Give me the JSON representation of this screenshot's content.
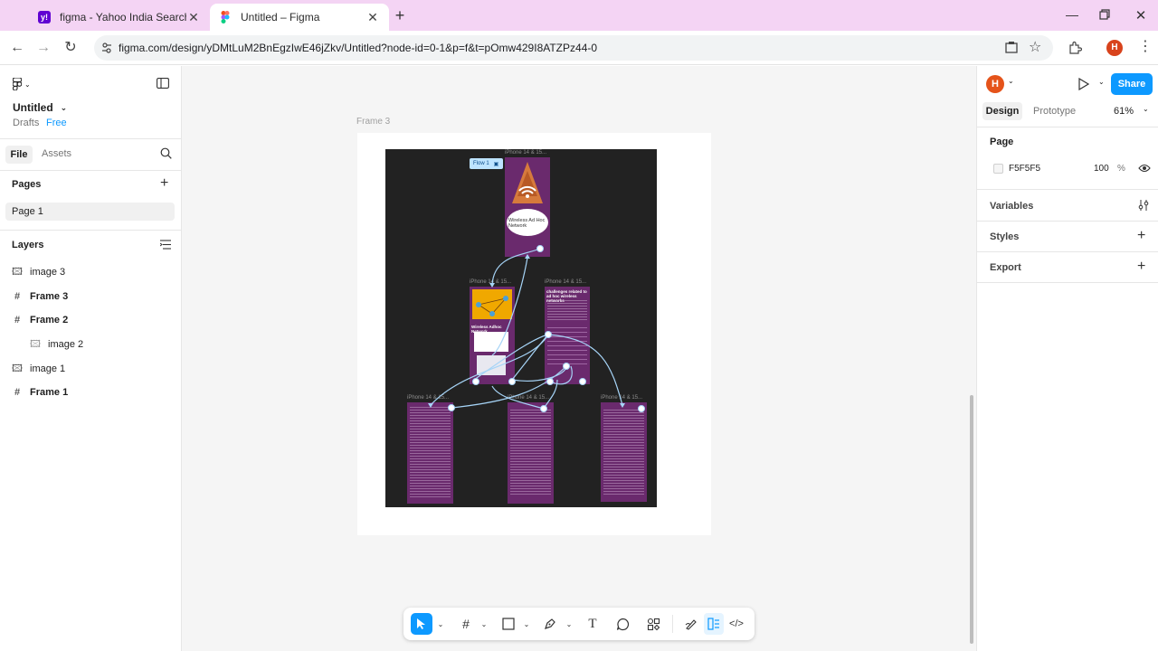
{
  "browser": {
    "tabs": [
      {
        "title": "figma - Yahoo India Search Res",
        "active": false
      },
      {
        "title": "Untitled – Figma",
        "active": true
      }
    ],
    "url": "figma.com/design/yDMtLuM2BnEgzIwE46jZkv/Untitled?node-id=0-1&p=f&t=pOmw429I8ATZPz44-0",
    "profile_initial": "H"
  },
  "left": {
    "file_title": "Untitled",
    "drafts": "Drafts",
    "plan": "Free",
    "tab_file": "File",
    "tab_assets": "Assets",
    "pages_heading": "Pages",
    "pages": [
      "Page 1"
    ],
    "layers_heading": "Layers",
    "layers": [
      {
        "name": "image 3",
        "icon": "image-icon",
        "indent": false
      },
      {
        "name": "Frame 3",
        "icon": "frame-icon",
        "indent": false
      },
      {
        "name": "Frame 2",
        "icon": "frame-icon",
        "indent": false
      },
      {
        "name": "image 2",
        "icon": "image-icon",
        "indent": true
      },
      {
        "name": "image 1",
        "icon": "image-icon",
        "indent": false
      },
      {
        "name": "Frame 1",
        "icon": "frame-icon",
        "indent": false
      }
    ]
  },
  "canvas": {
    "frame_label": "Frame 3",
    "flow_label": "Flow 1",
    "phone_label": "iPhone 14 & 15...",
    "card_title": "Wireless Ad Hoc Network",
    "slide_title": "Wireless Adhoc Network",
    "slide_challenges": "challenges related to ad hoc wireless networks"
  },
  "right": {
    "avatar": "H",
    "share": "Share",
    "tab_design": "Design",
    "tab_prototype": "Prototype",
    "zoom": "61%",
    "page_heading": "Page",
    "page_color": "F5F5F5",
    "page_opacity": "100",
    "percent": "%",
    "variables": "Variables",
    "styles": "Styles",
    "export": "Export"
  },
  "colors": {
    "accent": "#0d99ff",
    "canvas_bg": "#f5f5f5",
    "frame_dark": "#222222",
    "phone_purple": "#6a2a6d",
    "avatar": "#e5531a"
  }
}
